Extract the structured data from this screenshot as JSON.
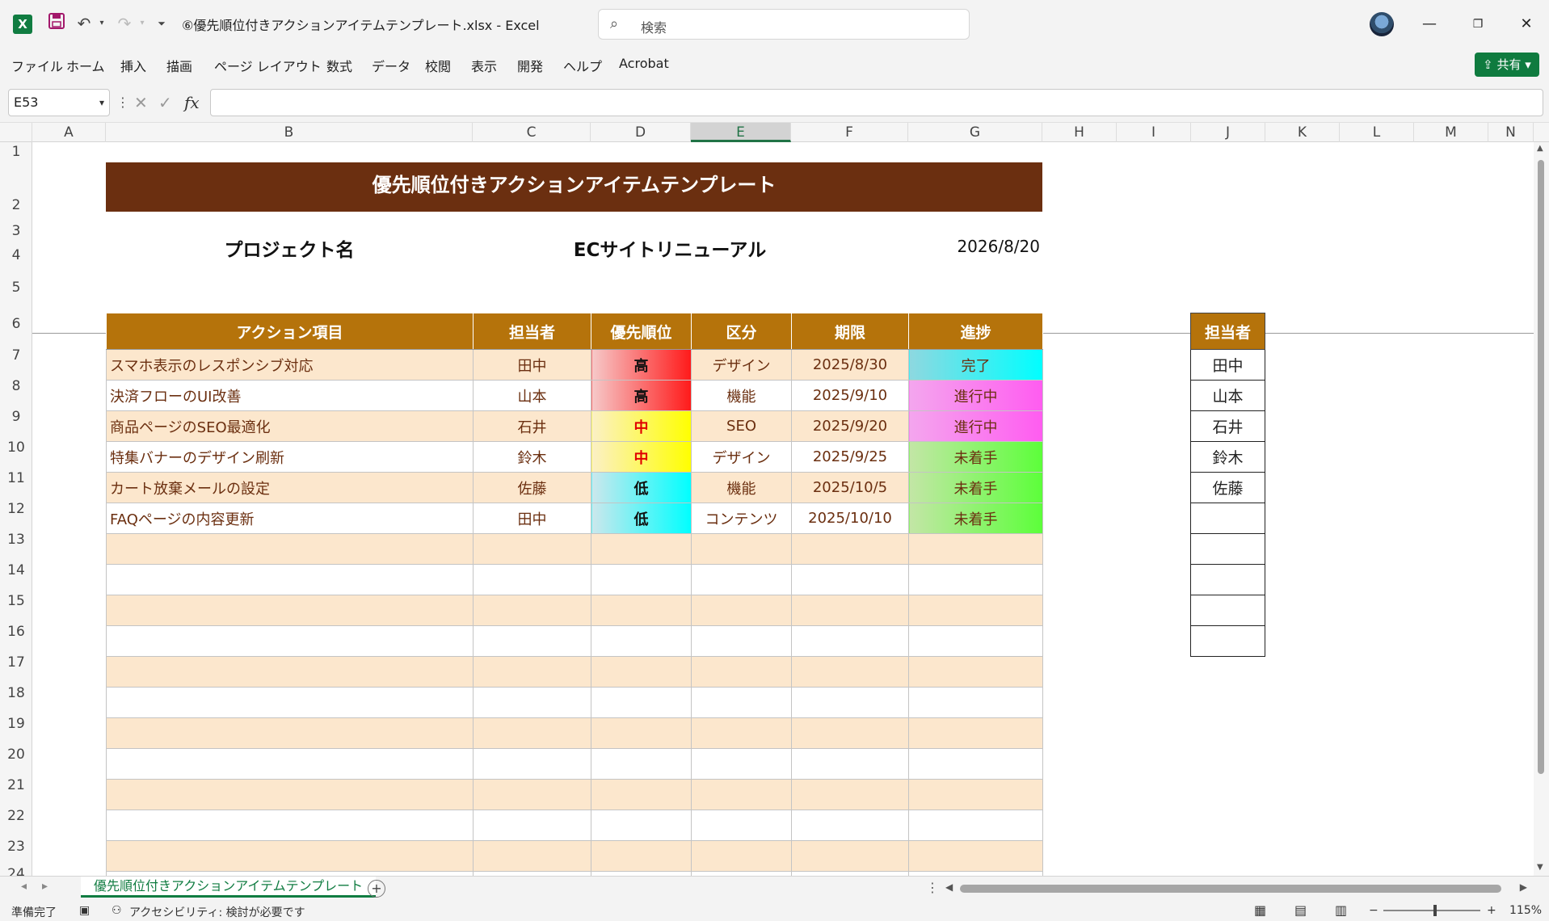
{
  "window": {
    "file_title": "⑥優先順位付きアクションアイテムテンプレート.xlsx  -  Excel",
    "search_placeholder": "検索"
  },
  "menu": {
    "items": [
      "ファイル",
      "ホーム",
      "挿入",
      "描画",
      "ページ レイアウト",
      "数式",
      "データ",
      "校閲",
      "表示",
      "開発",
      "ヘルプ",
      "Acrobat"
    ],
    "share_label": "共有"
  },
  "formula_bar": {
    "name_box": "E53",
    "formula": ""
  },
  "columns": [
    "A",
    "B",
    "C",
    "D",
    "E",
    "F",
    "G",
    "H",
    "I",
    "J",
    "K",
    "L",
    "M",
    "N"
  ],
  "selected_column": "E",
  "rows": [
    "1",
    "2",
    "3",
    "4",
    "5",
    "6",
    "7",
    "8",
    "9",
    "10",
    "11",
    "12",
    "13",
    "14",
    "15",
    "16",
    "17",
    "18",
    "19",
    "20",
    "21",
    "22",
    "23",
    "24"
  ],
  "sheet": {
    "title": "優先順位付きアクションアイテムテンプレート",
    "project_label": "プロジェクト名",
    "project_name": "ECサイトリニューアル",
    "date": "2026/8/20",
    "headers": [
      "アクション項目",
      "担当者",
      "優先順位",
      "区分",
      "期限",
      "進捗"
    ],
    "items": [
      {
        "action": "スマホ表示のレスポンシブ対応",
        "owner": "田中",
        "priority": "高",
        "category": "デザイン",
        "due": "2025/8/30",
        "progress": "完了"
      },
      {
        "action": "決済フローのUI改善",
        "owner": "山本",
        "priority": "高",
        "category": "機能",
        "due": "2025/9/10",
        "progress": "進行中"
      },
      {
        "action": "商品ページのSEO最適化",
        "owner": "石井",
        "priority": "中",
        "category": "SEO",
        "due": "2025/9/20",
        "progress": "進行中"
      },
      {
        "action": "特集バナーのデザイン刷新",
        "owner": "鈴木",
        "priority": "中",
        "category": "デザイン",
        "due": "2025/9/25",
        "progress": "未着手"
      },
      {
        "action": "カート放棄メールの設定",
        "owner": "佐藤",
        "priority": "低",
        "category": "機能",
        "due": "2025/10/5",
        "progress": "未着手"
      },
      {
        "action": "FAQページの内容更新",
        "owner": "田中",
        "priority": "低",
        "category": "コンテンツ",
        "due": "2025/10/10",
        "progress": "未着手"
      }
    ],
    "owner_list_header": "担当者",
    "owner_list": [
      "田中",
      "山本",
      "石井",
      "鈴木",
      "佐藤",
      "",
      "",
      "",
      "",
      ""
    ]
  },
  "colors": {
    "title_band": "#6b2f10",
    "header": "#b5730b",
    "row_alt": "#fce7cd",
    "priority_high": "#ff1a1a",
    "priority_mid": "#ffff00",
    "priority_low": "#00ffff",
    "progress_done": "#00ffff",
    "progress_doing": "#ff5cf0",
    "progress_todo": "#5cff3a"
  },
  "sheet_tab": "優先順位付きアクションアイテムテンプレート",
  "status": {
    "ready": "準備完了",
    "accessibility": "アクセシビリティ: 検討が必要です",
    "zoom": "115%"
  }
}
